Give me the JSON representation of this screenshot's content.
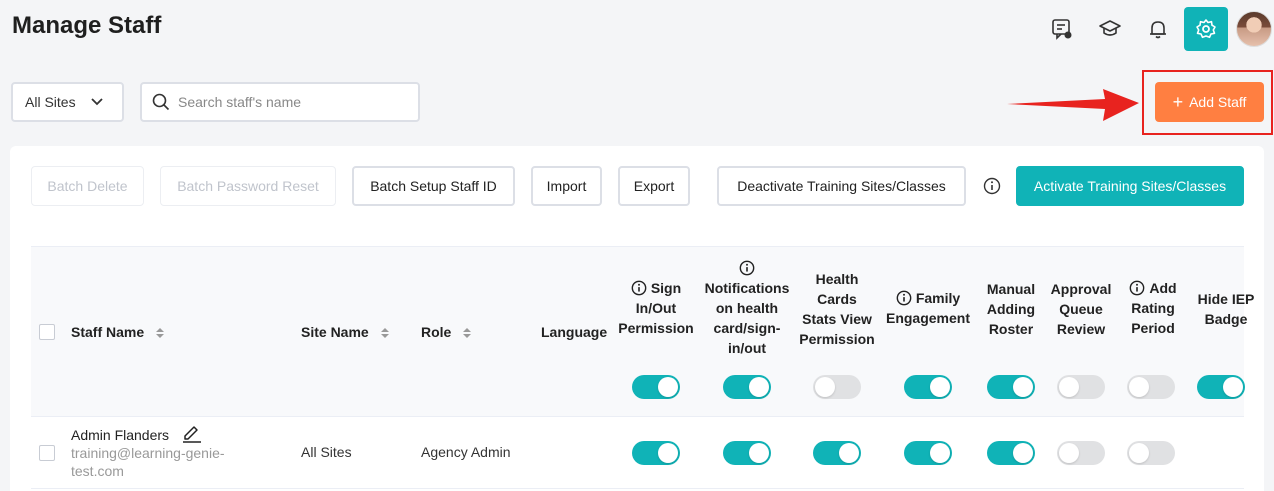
{
  "header": {
    "title": "Manage Staff",
    "icons": [
      "message-icon",
      "graduation-cap-icon",
      "bell-icon",
      "gear-icon",
      "avatar"
    ]
  },
  "filters": {
    "site_select": "All Sites",
    "search_placeholder": "Search staff's name"
  },
  "add_button": {
    "label": "Add Staff"
  },
  "toolbar": {
    "batch_delete": "Batch Delete",
    "batch_password_reset": "Batch Password Reset",
    "batch_setup_staff_id": "Batch Setup Staff ID",
    "import": "Import",
    "export": "Export",
    "deactivate": "Deactivate Training Sites/Classes",
    "activate": "Activate Training Sites/Classes"
  },
  "table": {
    "columns": {
      "staff_name": "Staff Name",
      "site_name": "Site Name",
      "role": "Role",
      "language": "Language",
      "sign_in_out_1": "Sign",
      "sign_in_out_2": "In/Out",
      "sign_in_out_3": "Permission",
      "notif_1": "Notifications",
      "notif_2": "on health",
      "notif_3": "card/sign-",
      "notif_4": "in/out",
      "health_1": "Health",
      "health_2": "Cards",
      "health_3": "Stats View",
      "health_4": "Permission",
      "family_1": "Family",
      "family_2": "Engagement",
      "manual_1": "Manual",
      "manual_2": "Adding",
      "manual_3": "Roster",
      "approval_1": "Approval",
      "approval_2": "Queue",
      "approval_3": "Review",
      "rating_1": "Add",
      "rating_2": "Rating",
      "rating_3": "Period",
      "hide_1": "Hide IEP",
      "hide_2": "Badge"
    },
    "header_toggles": [
      true,
      true,
      false,
      true,
      true,
      false,
      false,
      true
    ],
    "rows": [
      {
        "name": "Admin Flanders",
        "email": "training@learning-genie-test.com",
        "site": "All Sites",
        "role": "Agency Admin",
        "language": "",
        "toggles": [
          true,
          true,
          true,
          true,
          true,
          false,
          false
        ]
      }
    ]
  },
  "colors": {
    "primary": "#10b3b7",
    "accent": "#ff7f41",
    "highlight": "#e8231f"
  }
}
